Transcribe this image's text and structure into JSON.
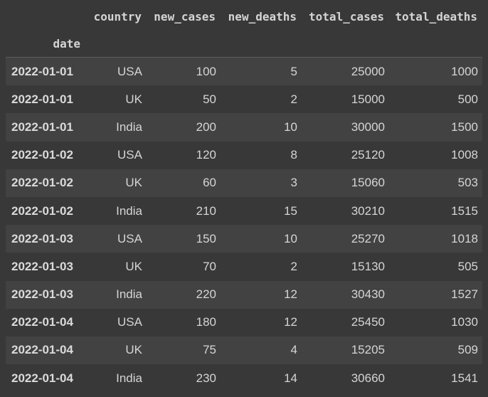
{
  "table": {
    "index_name": "date",
    "columns": [
      "country",
      "new_cases",
      "new_deaths",
      "total_cases",
      "total_deaths"
    ],
    "rows": [
      {
        "date": "2022-01-01",
        "country": "USA",
        "new_cases": "100",
        "new_deaths": "5",
        "total_cases": "25000",
        "total_deaths": "1000"
      },
      {
        "date": "2022-01-01",
        "country": "UK",
        "new_cases": "50",
        "new_deaths": "2",
        "total_cases": "15000",
        "total_deaths": "500"
      },
      {
        "date": "2022-01-01",
        "country": "India",
        "new_cases": "200",
        "new_deaths": "10",
        "total_cases": "30000",
        "total_deaths": "1500"
      },
      {
        "date": "2022-01-02",
        "country": "USA",
        "new_cases": "120",
        "new_deaths": "8",
        "total_cases": "25120",
        "total_deaths": "1008"
      },
      {
        "date": "2022-01-02",
        "country": "UK",
        "new_cases": "60",
        "new_deaths": "3",
        "total_cases": "15060",
        "total_deaths": "503"
      },
      {
        "date": "2022-01-02",
        "country": "India",
        "new_cases": "210",
        "new_deaths": "15",
        "total_cases": "30210",
        "total_deaths": "1515"
      },
      {
        "date": "2022-01-03",
        "country": "USA",
        "new_cases": "150",
        "new_deaths": "10",
        "total_cases": "25270",
        "total_deaths": "1018"
      },
      {
        "date": "2022-01-03",
        "country": "UK",
        "new_cases": "70",
        "new_deaths": "2",
        "total_cases": "15130",
        "total_deaths": "505"
      },
      {
        "date": "2022-01-03",
        "country": "India",
        "new_cases": "220",
        "new_deaths": "12",
        "total_cases": "30430",
        "total_deaths": "1527"
      },
      {
        "date": "2022-01-04",
        "country": "USA",
        "new_cases": "180",
        "new_deaths": "12",
        "total_cases": "25450",
        "total_deaths": "1030"
      },
      {
        "date": "2022-01-04",
        "country": "UK",
        "new_cases": "75",
        "new_deaths": "4",
        "total_cases": "15205",
        "total_deaths": "509"
      },
      {
        "date": "2022-01-04",
        "country": "India",
        "new_cases": "230",
        "new_deaths": "14",
        "total_cases": "30660",
        "total_deaths": "1541"
      }
    ]
  },
  "colors": {
    "background": "#383838",
    "row_alt": "#424242",
    "text": "#d5d5d5"
  }
}
